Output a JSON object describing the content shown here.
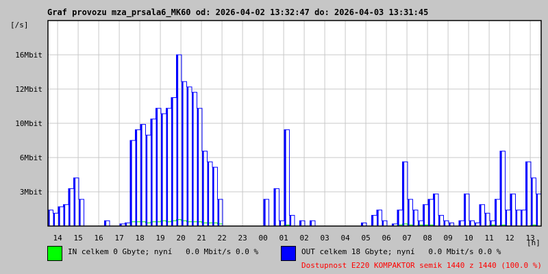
{
  "chart_data": {
    "type": "line",
    "title": "Graf provozu mza_prsala6_MK60 od: 2026-04-02 13:32:47 do: 2026-04-03 13:31:45",
    "ylabel": "[/s]",
    "xlabel": "[h]",
    "y_unit": "Mbit/s",
    "ylim": [
      0,
      19.2
    ],
    "y_ticks": [
      {
        "label": "3Mbit",
        "v": 3.2
      },
      {
        "label": "6Mbit",
        "v": 6.4
      },
      {
        "label": "10Mbit",
        "v": 9.6
      },
      {
        "label": "12Mbit",
        "v": 12.8
      },
      {
        "label": "16Mbit",
        "v": 16
      }
    ],
    "x_start_hour": 13.53,
    "x_span_hours": 24,
    "sample_minutes": 15,
    "x_ticks": [
      "14",
      "15",
      "16",
      "17",
      "18",
      "19",
      "20",
      "21",
      "22",
      "23",
      "00",
      "01",
      "02",
      "03",
      "04",
      "05",
      "06",
      "07",
      "08",
      "09",
      "10",
      "11",
      "12",
      "13"
    ],
    "grid": true,
    "series": [
      {
        "name": "IN",
        "color": "#00ff00",
        "values": [
          0,
          0,
          0,
          0,
          0,
          0,
          0,
          0,
          0,
          0,
          0,
          0,
          0,
          0,
          0,
          0,
          0.4,
          0.4,
          0.4,
          0.3,
          0.4,
          0.4,
          0.5,
          0.4,
          0.5,
          0.6,
          0.5,
          0.4,
          0.4,
          0.4,
          0.3,
          0.3,
          0.3,
          0.2,
          0,
          0,
          0,
          0,
          0,
          0,
          0,
          0,
          0,
          0,
          0,
          0,
          0.1,
          0,
          0,
          0,
          0,
          0,
          0,
          0,
          0,
          0,
          0,
          0,
          0,
          0,
          0,
          0,
          0,
          0,
          0,
          0,
          0,
          0,
          0.1,
          0.2,
          0.1,
          0,
          0.1,
          0.1,
          0.1,
          0,
          0,
          0,
          0,
          0,
          0,
          0,
          0,
          0,
          0,
          0,
          0.1,
          0,
          0.1,
          0,
          0,
          0,
          0,
          0,
          0.1,
          0
        ]
      },
      {
        "name": "OUT",
        "color": "#0000ff",
        "values": [
          1.5,
          1.2,
          1.8,
          2,
          3.5,
          4.5,
          2.5,
          0,
          0,
          0,
          0,
          0.5,
          0,
          0,
          0.2,
          0.3,
          8,
          9,
          9.5,
          8.5,
          10,
          11,
          10.5,
          11,
          12,
          16,
          13.5,
          13,
          12.5,
          11,
          7,
          6,
          5.5,
          2.5,
          0,
          0,
          0,
          0,
          0,
          0,
          0,
          0,
          2.5,
          0,
          3.5,
          0.5,
          9,
          1,
          0,
          0.5,
          0,
          0.5,
          0,
          0,
          0,
          0,
          0,
          0,
          0,
          0,
          0,
          0.3,
          0,
          1,
          1.5,
          0.5,
          0,
          0.2,
          1.5,
          6,
          2.5,
          1.5,
          0.5,
          2,
          2.5,
          3,
          1,
          0.5,
          0.3,
          0,
          0.5,
          3,
          0.5,
          0.3,
          2,
          1.2,
          0.5,
          2.5,
          7,
          1.5,
          3,
          1.5,
          1.5,
          6,
          4.5,
          3
        ]
      }
    ]
  },
  "legend": {
    "in_text": "IN celkem 0 Gbyte; nyní   0.0 Mbit/s 0.0 %",
    "out_text": "OUT celkem 18 Gbyte; nyní   0.0 Mbit/s 0.0 %",
    "availability": "Dostupnost E220 KOMPAKTOR semik 1440 z 1440 (100.0 %)",
    "availability_color": "#ff0000"
  }
}
